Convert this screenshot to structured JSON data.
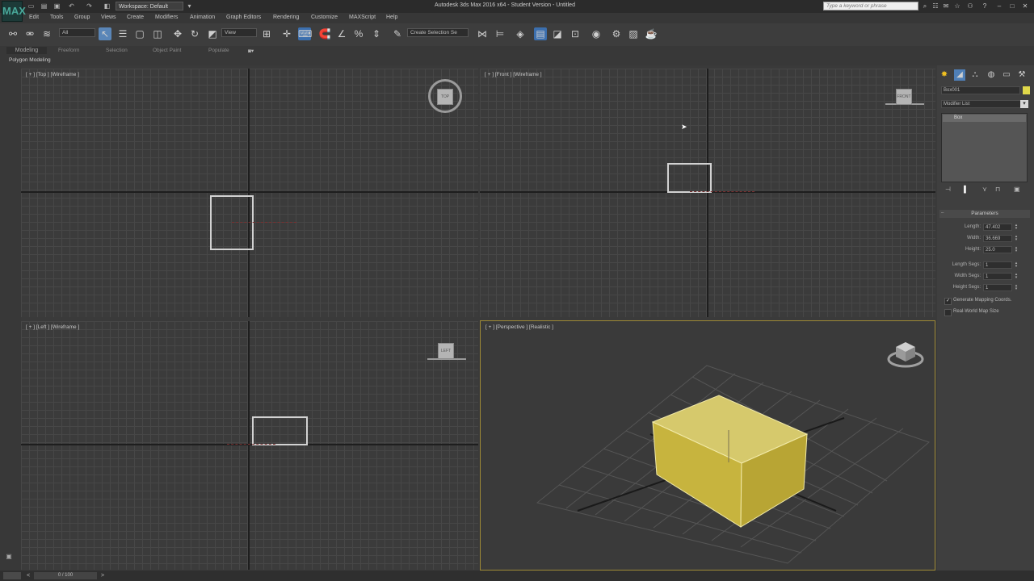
{
  "window": {
    "title": "Autodesk 3ds Max 2016 x64 - Student Version - Untitled",
    "workspace": "Workspace: Default",
    "search_placeholder": "Type a keyword or phrase",
    "logo": "MAX"
  },
  "menu": [
    "Edit",
    "Tools",
    "Group",
    "Views",
    "Create",
    "Modifiers",
    "Animation",
    "Graph Editors",
    "Rendering",
    "Customize",
    "MAXScript",
    "Help"
  ],
  "toolbar": {
    "selection_filter": "All",
    "reference_coord": "View",
    "named_selection": "Create Selection Se"
  },
  "ribbon": {
    "tabs": [
      "Modeling",
      "Freeform",
      "Selection",
      "Object Paint",
      "Populate"
    ],
    "active_tab": "Modeling",
    "panel_label": "Polygon Modeling"
  },
  "viewports": {
    "top": "[ + ] [Top ] [Wireframe ]",
    "front": "[ + ] [Front ] [Wireframe ]",
    "left": "[ + ] [Left ] [Wireframe ]",
    "perspective": "[ + ] [Perspective ] [Realistic ]",
    "viewcube_top": "TOP",
    "viewcube_front": "FRONT",
    "viewcube_left": "LEFT"
  },
  "command_panel": {
    "object_name": "Box001",
    "modifier_list": "Modifier List",
    "stack_items": [
      "Box"
    ],
    "rollout_title": "Parameters",
    "params": [
      {
        "label": "Length:",
        "value": "47.402"
      },
      {
        "label": "Width:",
        "value": "36.669"
      },
      {
        "label": "Height:",
        "value": "25.0"
      },
      {
        "label": "Length Segs:",
        "value": "1"
      },
      {
        "label": "Width Segs:",
        "value": "1"
      },
      {
        "label": "Height Segs:",
        "value": "1"
      }
    ],
    "checkboxes": [
      {
        "label": "Generate Mapping Coords.",
        "checked": true
      },
      {
        "label": "Real-World Map Size",
        "checked": false
      }
    ],
    "object_color": "#e0d84a"
  },
  "status": {
    "frame": "0 / 100"
  },
  "colors": {
    "box_yellow": "#d9c863",
    "selection_border": "#9f8a36",
    "active_tool": "#5a86b8"
  }
}
